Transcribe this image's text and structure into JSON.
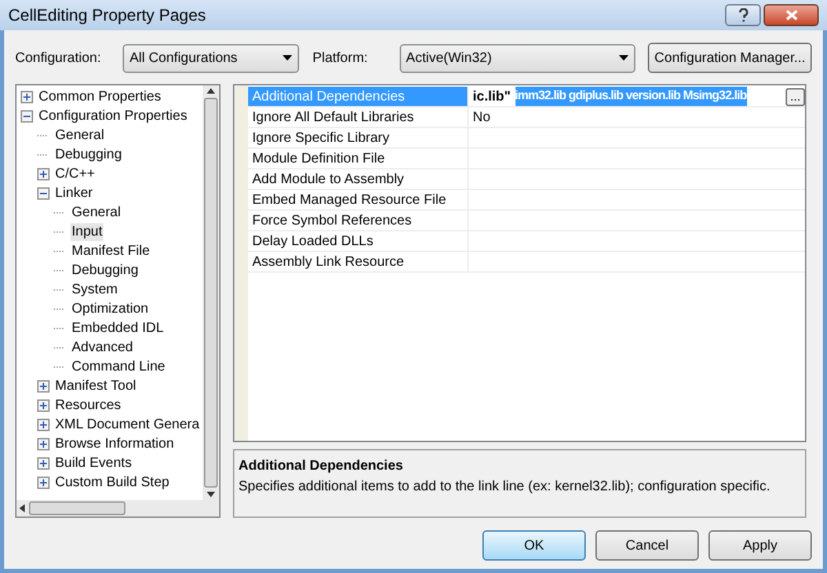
{
  "window": {
    "title": "CellEditing Property Pages"
  },
  "configuration": {
    "label": "Configuration:",
    "value": "All Configurations"
  },
  "platform": {
    "label": "Platform:",
    "value": "Active(Win32)"
  },
  "config_manager_button": "Configuration Manager...",
  "tree": [
    {
      "label": "Common Properties",
      "expanded": false,
      "selected": false
    },
    {
      "label": "Configuration Properties",
      "expanded": true,
      "selected": false,
      "children": [
        {
          "label": "General",
          "selected": false
        },
        {
          "label": "Debugging",
          "selected": false
        },
        {
          "label": "C/C++",
          "expanded": false,
          "selected": false
        },
        {
          "label": "Linker",
          "expanded": true,
          "selected": false,
          "children": [
            {
              "label": "General",
              "selected": false
            },
            {
              "label": "Input",
              "selected": true
            },
            {
              "label": "Manifest File",
              "selected": false
            },
            {
              "label": "Debugging",
              "selected": false
            },
            {
              "label": "System",
              "selected": false
            },
            {
              "label": "Optimization",
              "selected": false
            },
            {
              "label": "Embedded IDL",
              "selected": false
            },
            {
              "label": "Advanced",
              "selected": false
            },
            {
              "label": "Command Line",
              "selected": false
            }
          ]
        },
        {
          "label": "Manifest Tool",
          "expanded": false,
          "selected": false
        },
        {
          "label": "Resources",
          "expanded": false,
          "selected": false
        },
        {
          "label": "XML Document Genera",
          "expanded": false,
          "selected": false
        },
        {
          "label": "Browse Information",
          "expanded": false,
          "selected": false
        },
        {
          "label": "Build Events",
          "expanded": false,
          "selected": false
        },
        {
          "label": "Custom Build Step",
          "expanded": false,
          "selected": false
        }
      ]
    }
  ],
  "properties": [
    {
      "name": "Additional Dependencies",
      "selected": true,
      "value": "ic.lib\"",
      "value_selected_text": "imm32.lib gdiplus.lib version.lib Msimg32.lib",
      "ellipsis_button": "..."
    },
    {
      "name": "Ignore All Default Libraries",
      "selected": false,
      "value": "No"
    },
    {
      "name": "Ignore Specific Library",
      "selected": false
    },
    {
      "name": "Module Definition File",
      "selected": false
    },
    {
      "name": "Add Module to Assembly",
      "selected": false
    },
    {
      "name": "Embed Managed Resource File",
      "selected": false
    },
    {
      "name": "Force Symbol References",
      "selected": false
    },
    {
      "name": "Delay Loaded DLLs",
      "selected": false
    },
    {
      "name": "Assembly Link Resource",
      "selected": false
    }
  ],
  "description": {
    "title": "Additional Dependencies",
    "text": "Specifies additional items to add to the link line (ex: kernel32.lib); configuration specific."
  },
  "buttons": [
    {
      "label": "OK",
      "default": true
    },
    {
      "label": "Cancel",
      "default": false
    },
    {
      "label": "Apply",
      "default": false
    }
  ]
}
